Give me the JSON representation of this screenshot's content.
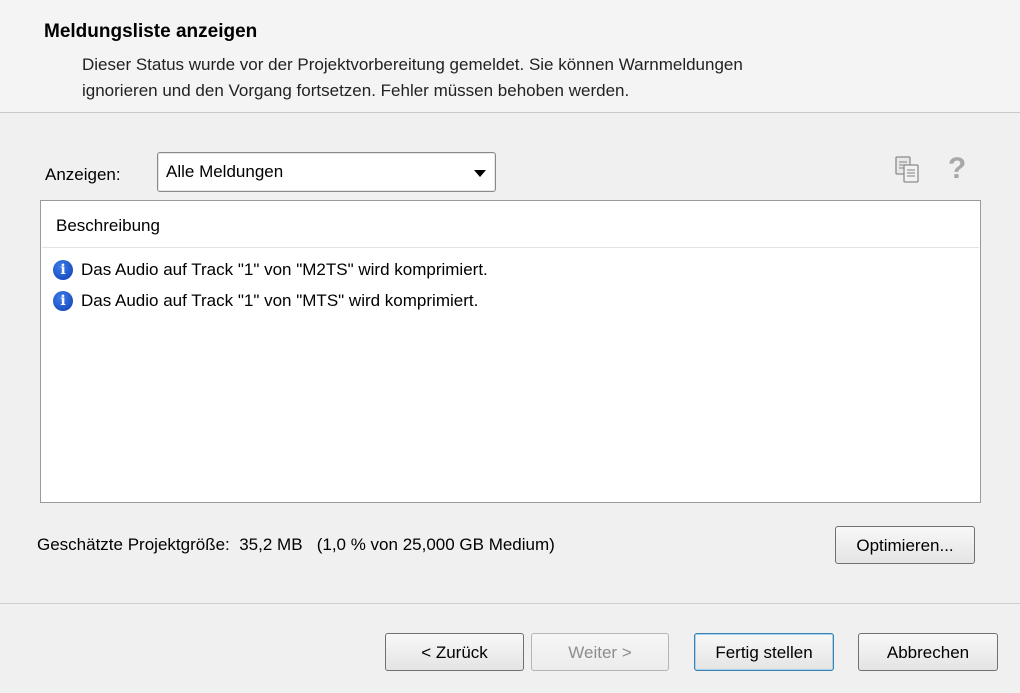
{
  "header": {
    "title": "Meldungsliste anzeigen",
    "description_line1": "Dieser Status wurde vor der Projektvorbereitung gemeldet. Sie können Warnmeldungen",
    "description_line2": "ignorieren und den Vorgang fortsetzen. Fehler müssen behoben werden."
  },
  "filter": {
    "label": "Anzeigen:",
    "selected": "Alle Meldungen"
  },
  "toolbar": {
    "copy_icon": "copy-icon",
    "help_icon": "help-icon",
    "help_glyph": "?"
  },
  "list": {
    "column_header": "Beschreibung",
    "items": [
      {
        "icon": "info-icon",
        "text": "Das Audio auf Track \"1\" von \"M2TS\" wird komprimiert."
      },
      {
        "icon": "info-icon",
        "text": "Das Audio auf Track \"1\" von \"MTS\" wird komprimiert."
      }
    ]
  },
  "project_size": {
    "label": "Geschätzte Projektgröße:",
    "value": "35,2 MB",
    "detail": "(1,0 % von 25,000 GB Medium)"
  },
  "buttons": {
    "optimize": "Optimieren...",
    "back": "< Zurück",
    "next": "Weiter >",
    "finish": "Fertig stellen",
    "cancel": "Abbrechen"
  },
  "colors": {
    "info_icon": "#1a4fd0",
    "disabled_text": "#8d8d8d"
  }
}
